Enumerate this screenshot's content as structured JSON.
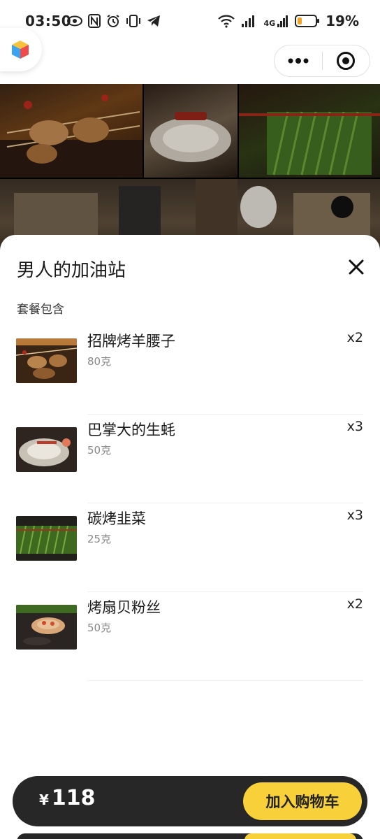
{
  "status_bar": {
    "time": "03:50",
    "battery_percent": "19%",
    "network_label": "4G"
  },
  "miniapp": {
    "more_icon": "more-dots-icon",
    "close_icon": "target-close-icon"
  },
  "sheet": {
    "title": "男人的加油站",
    "section_label": "套餐包含",
    "items": [
      {
        "name": "招牌烤羊腰子",
        "weight": "80克",
        "qty": "x2"
      },
      {
        "name": "巴掌大的生蚝",
        "weight": "50克",
        "qty": "x3"
      },
      {
        "name": "碳烤韭菜",
        "weight": "25克",
        "qty": "x3"
      },
      {
        "name": "烤扇贝粉丝",
        "weight": "50克",
        "qty": "x2"
      }
    ]
  },
  "checkout": {
    "currency": "¥",
    "price": "118",
    "add_to_cart": "加入购物车"
  },
  "colors": {
    "accent_yellow": "#f7d03a",
    "bar_dark": "#272727"
  }
}
